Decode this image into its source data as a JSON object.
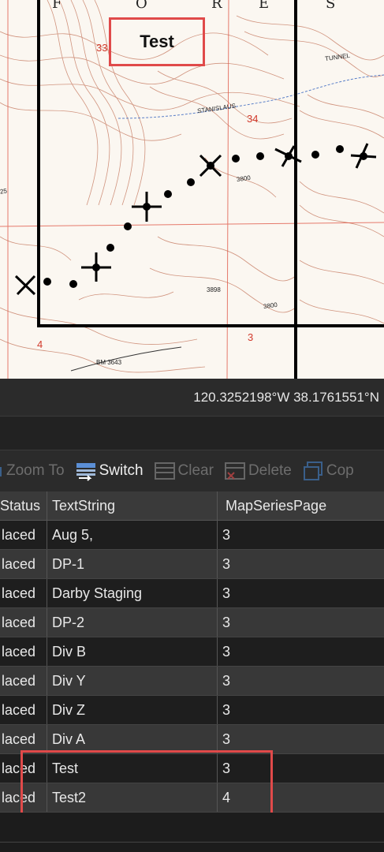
{
  "map": {
    "sheet_letters": [
      "F",
      "O",
      "R",
      "E",
      "S"
    ],
    "highlight_label": "Test",
    "grid_numbers": [
      "33",
      "34",
      "4",
      "3",
      "25"
    ],
    "place_labels": [
      "STANISLAUS",
      "TUNNEL",
      "3898",
      "BM 3643",
      "3800",
      "3800"
    ],
    "accent_color": "#e04a4a"
  },
  "status_bar": {
    "coordinates": "120.3252198°W 38.1761551°N"
  },
  "toolbar": {
    "zoom_to_label": "Zoom To",
    "switch_label": "Switch",
    "clear_label": "Clear",
    "delete_label": "Delete",
    "copy_label": "Cop"
  },
  "table": {
    "headers": {
      "status": "Status",
      "text_string": "TextString",
      "map_series_page": "MapSeriesPage"
    },
    "rows": [
      {
        "status": "laced",
        "text_string": "Aug 5,",
        "page": "3"
      },
      {
        "status": "laced",
        "text_string": "DP-1",
        "page": "3"
      },
      {
        "status": "laced",
        "text_string": "Darby Staging",
        "page": "3"
      },
      {
        "status": "laced",
        "text_string": "DP-2",
        "page": "3"
      },
      {
        "status": "laced",
        "text_string": "Div B",
        "page": "3"
      },
      {
        "status": "laced",
        "text_string": "Div Y",
        "page": "3"
      },
      {
        "status": "laced",
        "text_string": "Div Z",
        "page": "3"
      },
      {
        "status": "laced",
        "text_string": "Div A",
        "page": "3"
      },
      {
        "status": "laced",
        "text_string": "Test",
        "page": "3"
      },
      {
        "status": "laced",
        "text_string": "Test2",
        "page": "4"
      }
    ]
  }
}
